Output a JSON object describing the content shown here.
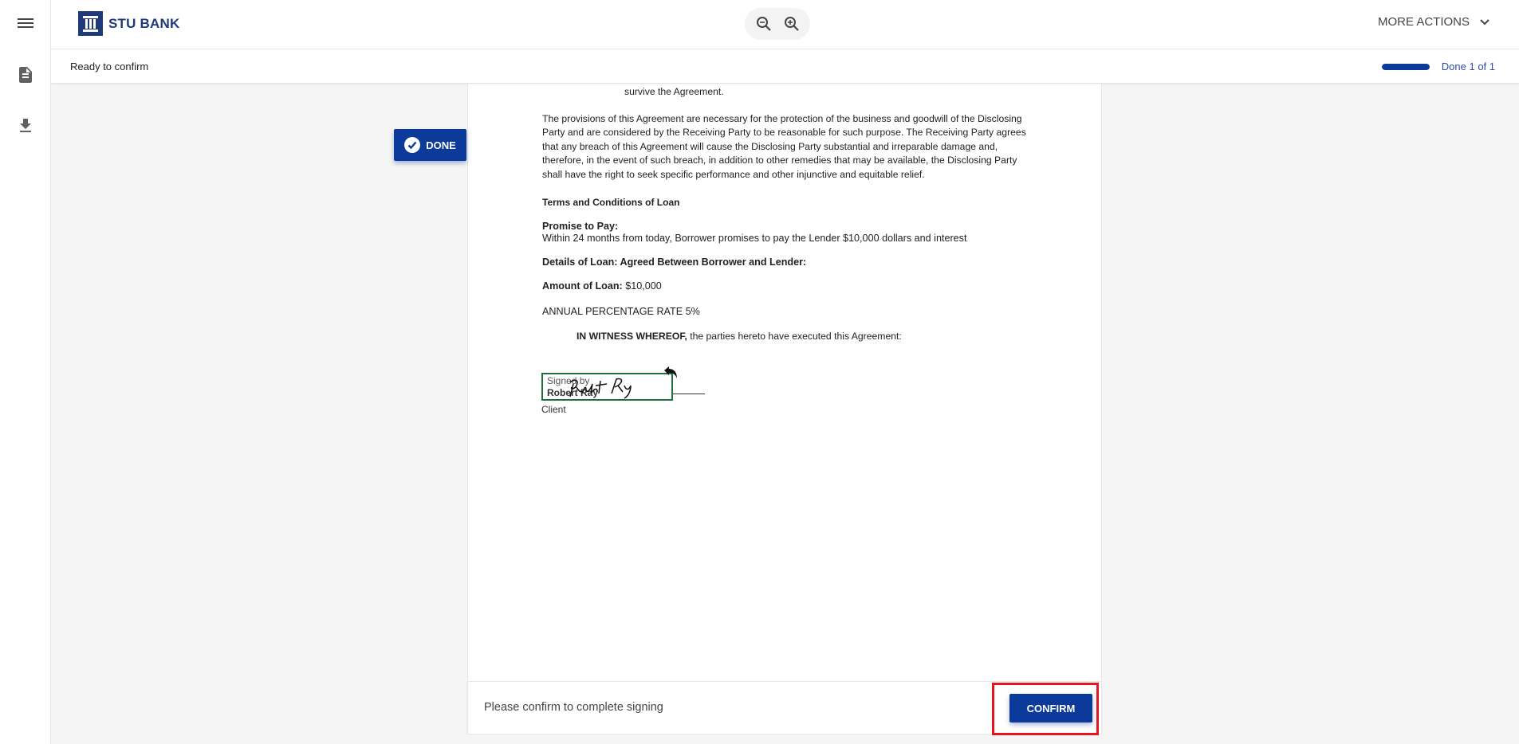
{
  "app": {
    "brand_name": "STU BANK",
    "brand_color": "#1f3a7a",
    "accent_color": "#0b3a9a"
  },
  "sidebar": {
    "items": [
      {
        "name": "menu",
        "icon": "hamburger-menu-icon"
      },
      {
        "name": "document",
        "icon": "document-icon"
      },
      {
        "name": "download",
        "icon": "download-icon"
      }
    ]
  },
  "toolbar": {
    "zoom_out_icon": "zoom-out-icon",
    "zoom_in_icon": "zoom-in-icon",
    "more_actions_label": "MORE ACTIONS"
  },
  "status": {
    "text": "Ready to confirm",
    "progress_fraction": 1.0,
    "progress_label": "Done 1 of 1"
  },
  "done_button": {
    "label": "DONE",
    "icon": "check-circle-icon"
  },
  "document": {
    "survive_line": "survive the Agreement.",
    "provisions_paragraph": "The provisions of this Agreement are necessary for the protection of the business and goodwill of the Disclosing Party and are considered by the Receiving Party to be reasonable for such purpose. The Receiving Party agrees that any breach of this Agreement will cause the Disclosing Party substantial and irreparable damage and, therefore, in the event of such breach, in addition to other remedies that may be available, the Disclosing Party shall have the right to seek specific performance and other injunctive and equitable relief.",
    "terms_heading": "Terms and Conditions of Loan",
    "promise_heading": "Promise to Pay:",
    "promise_text": "Within 24 months from today, Borrower promises to pay the Lender $10,000 dollars and interest",
    "details_heading": "Details of Loan: Agreed Between Borrower and Lender:",
    "amount_label": "Amount of Loan:",
    "amount_value": " $10,000",
    "apr_label": "ANNUAL PERCENTAGE RATE",
    "apr_value": " 5%",
    "witness_bold": "IN WITNESS WHEREOF,",
    "witness_text": " the parties hereto have executed this Agreement:",
    "signature": {
      "signed_by_label": "Signed by",
      "signer_name": "Robert Ray",
      "role": "Client",
      "box_color": "#1e6e3e"
    }
  },
  "footer": {
    "text": "Please confirm to complete signing",
    "confirm_label": "CONFIRM",
    "highlight_color": "#e8151e"
  }
}
